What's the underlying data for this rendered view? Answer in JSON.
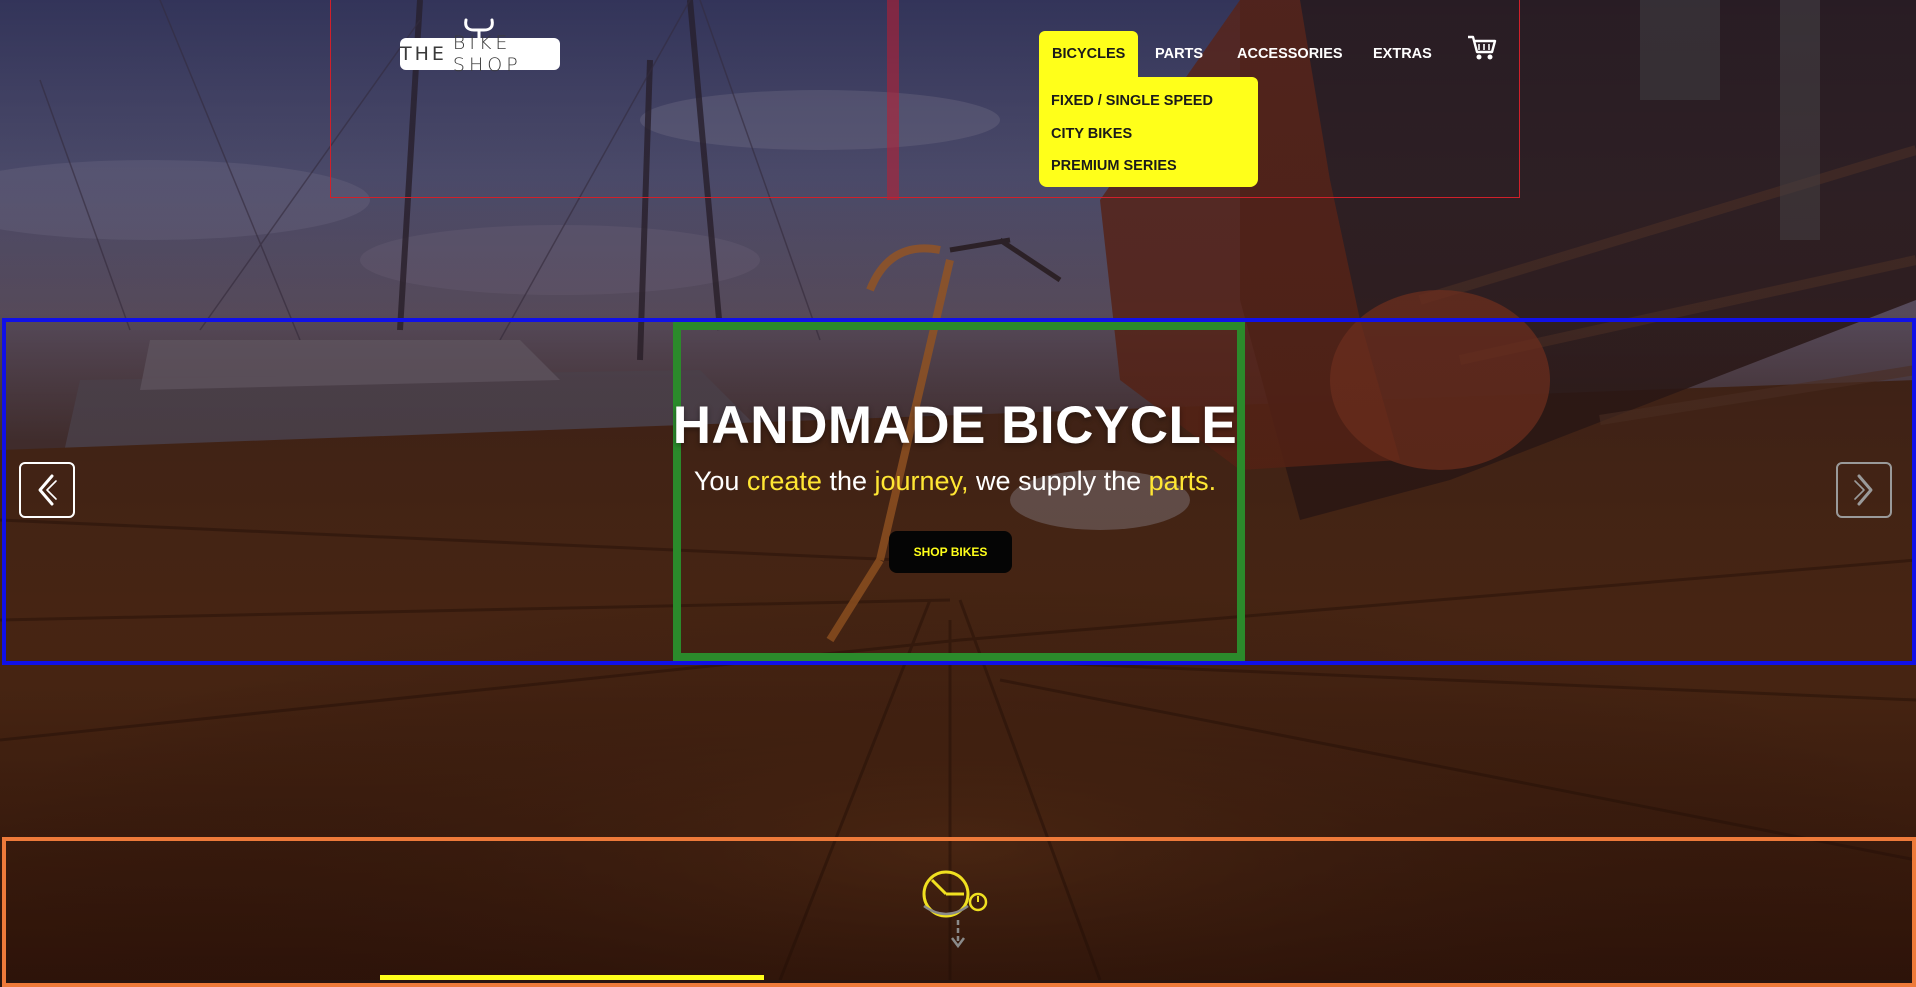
{
  "header": {
    "logo": {
      "text_1": "THE",
      "text_2": "BIKE SHOP"
    },
    "nav": [
      {
        "label": "BICYCLES",
        "active": true
      },
      {
        "label": "PARTS",
        "active": false
      },
      {
        "label": "ACCESSORIES",
        "active": false
      },
      {
        "label": "EXTRAS",
        "active": false
      }
    ],
    "dropdown": [
      {
        "label": "FIXED / SINGLE SPEED"
      },
      {
        "label": "CITY BIKES"
      },
      {
        "label": "PREMIUM SERIES"
      }
    ],
    "cart_icon": "shopping-cart-icon"
  },
  "hero": {
    "title": "HANDMADE BICYCLE",
    "subtitle": {
      "w1": "You ",
      "w2": "create",
      "w3": " the ",
      "w4": "journey,",
      "w5": " we supply the ",
      "w6": "parts."
    },
    "button_label": "SHOP BIKES",
    "prev_icon": "chevron-left-icon",
    "next_icon": "chevron-right-icon"
  },
  "bottom": {
    "icon": "bicycle-clock-icon",
    "scroll_icon": "arrow-down-icon"
  },
  "colors": {
    "accent": "#ffff1a",
    "highlight_text": "#ffe633",
    "button_bg": "#050505",
    "outline_header": "#d0202a",
    "outline_hero": "#1010e8",
    "outline_hero_inner": "#2b8a2b",
    "outline_bottom": "#ee7a3a"
  }
}
